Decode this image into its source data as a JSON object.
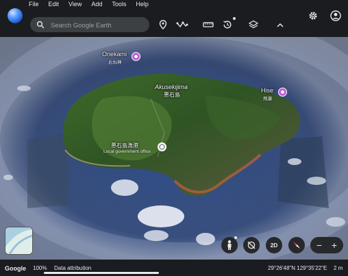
{
  "menu": [
    "File",
    "Edit",
    "View",
    "Add",
    "Tools",
    "Help"
  ],
  "search": {
    "placeholder": "Search Google Earth"
  },
  "places": {
    "onekami": {
      "name": "Onekami",
      "sub": "おね神"
    },
    "hise": {
      "name": "Hise",
      "sub": "飛瀬"
    },
    "island": {
      "name": "Akusekijima",
      "sub": "悪石島"
    },
    "office": {
      "name": "悪石島漁港",
      "sub": "Local government office"
    }
  },
  "controls": {
    "two_d": "2D"
  },
  "status": {
    "brand": "Google",
    "zoom": "100%",
    "attribution": "Data attribution",
    "coordinates": "29°26'48\"N 129°35'22\"E",
    "scale": "2 m"
  },
  "colors": {
    "pin": "#c05ad6",
    "chrome": "#1b1c1f",
    "ocean": "#1e3566"
  }
}
